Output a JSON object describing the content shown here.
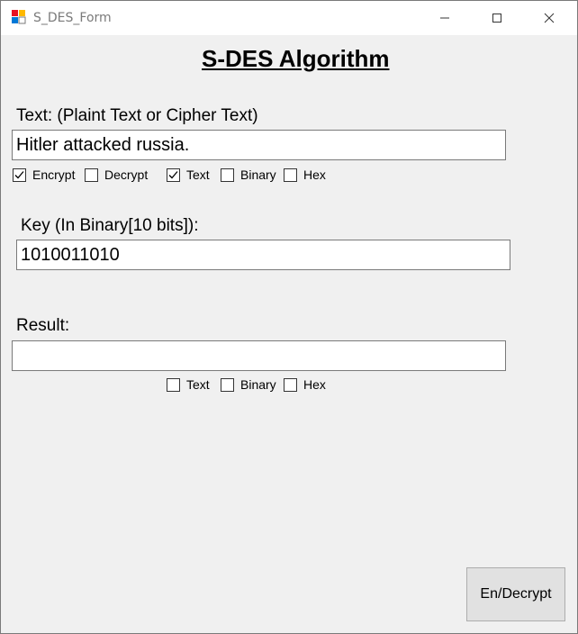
{
  "window": {
    "title": "S_DES_Form"
  },
  "form": {
    "heading": "S-DES Algorithm",
    "text_label": "Text: (Plaint Text or Cipher Text)",
    "text_value": "Hitler attacked russia.",
    "input_options": [
      {
        "label": "Encrypt",
        "checked": true
      },
      {
        "label": "Decrypt",
        "checked": false
      },
      {
        "label": "Text",
        "checked": true
      },
      {
        "label": "Binary",
        "checked": false
      },
      {
        "label": "Hex",
        "checked": false
      }
    ],
    "key_label": "Key (In Binary[10 bits]):",
    "key_value": "1010011010",
    "result_label": "Result:",
    "result_value": "",
    "result_options": [
      {
        "label": "Text",
        "checked": false
      },
      {
        "label": "Binary",
        "checked": false
      },
      {
        "label": "Hex",
        "checked": false
      }
    ],
    "action_button": "En/Decrypt"
  }
}
